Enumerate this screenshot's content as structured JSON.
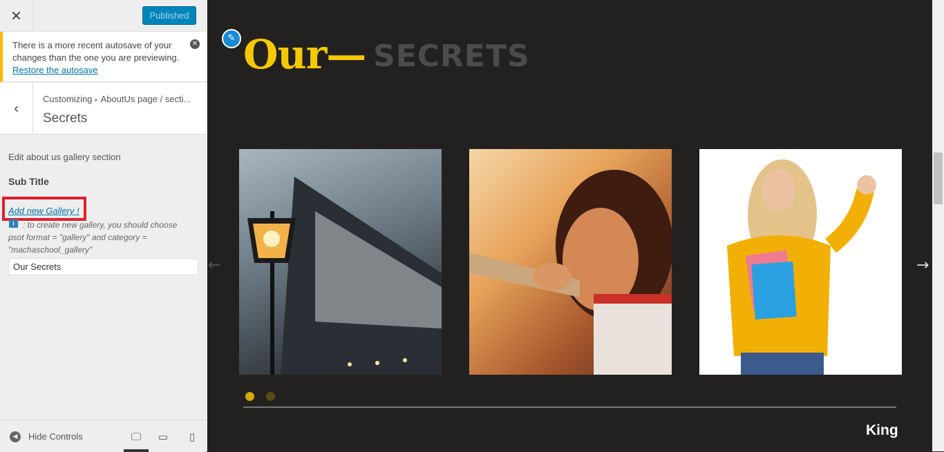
{
  "topbar": {
    "close_icon": "close-icon",
    "publish_label": "Published"
  },
  "notice": {
    "text": "There is a more recent autosave of your changes than the one you are previewing.",
    "link": "Restore the autosave",
    "dismiss_icon": "dismiss-icon"
  },
  "section": {
    "breadcrumb_root": "Customizing",
    "breadcrumb_parent": "AboutUs page / secti...",
    "title": "Secrets"
  },
  "form": {
    "description": "Edit about us gallery section",
    "subtitle_label": "Sub Title",
    "gallery_link": "Add new Gallery !",
    "help_text": ": to create new gallery, you should choose psot format = \"gallery\" and category = \"machaschool_gallery\"",
    "subtitle_value": "Our Secrets"
  },
  "footer": {
    "hide_label": "Hide Controls",
    "devices": [
      "desktop",
      "tablet",
      "mobile"
    ]
  },
  "preview": {
    "heading_our": "Our—",
    "heading_secrets": "SECRETS",
    "slides": [
      "street lamp photo",
      "girl at sunset photo",
      "student with books photo"
    ],
    "active_dot": 1,
    "dot_count": 2,
    "footer_name": "King"
  },
  "colors": {
    "accent": "#f5c900",
    "publish": "#0085ba",
    "highlight_box": "#e0202a",
    "preview_bg": "#232120"
  }
}
